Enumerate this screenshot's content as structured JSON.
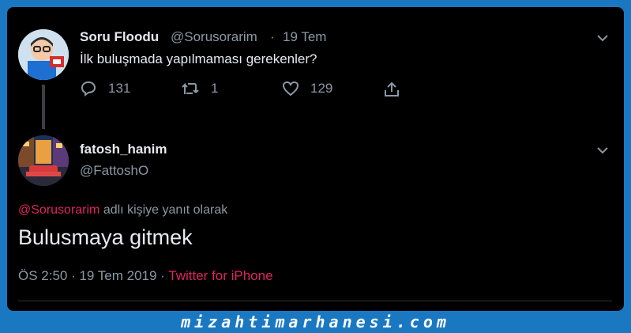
{
  "tweet_parent": {
    "name": "Soru Floodu",
    "handle": "@Sorusorarim",
    "separator": "·",
    "date": "19 Tem",
    "text": "İlk buluşmada yapılmaması gerekenler?",
    "replies": "131",
    "retweets": "1",
    "likes": "129"
  },
  "tweet_reply": {
    "name": "fatosh_hanim",
    "handle": "@FattoshO",
    "reply_to_mention": "@Sorusorarim",
    "reply_to_suffix": " adlı kişiye yanıt olarak",
    "text": "Bulusmaya gitmek",
    "timestamp": "ÖS 2:50 · 19 Tem 2019 · ",
    "source": "Twitter for iPhone"
  },
  "watermark": "mizahtimarhanesi.com",
  "colors": {
    "background": "#000000",
    "frame_border": "#1a78c2",
    "accent": "#e0245e",
    "muted": "#8b98a5"
  }
}
